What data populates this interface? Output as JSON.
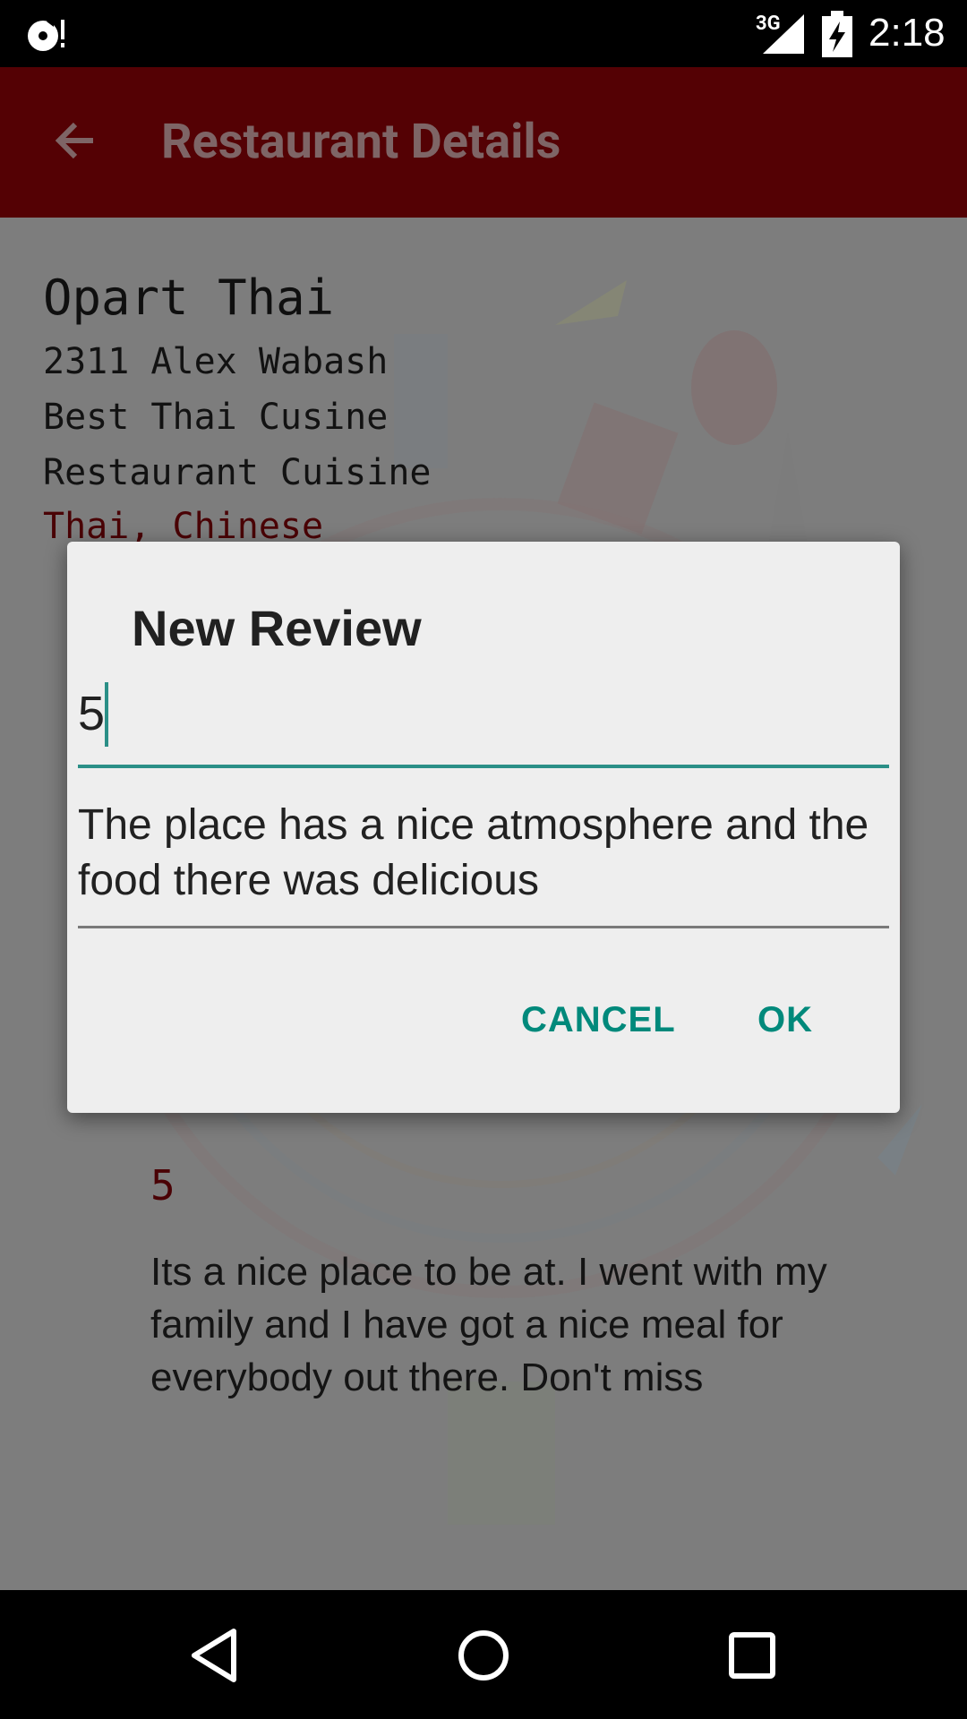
{
  "status_bar": {
    "network": "3G",
    "time": "2:18"
  },
  "app_bar": {
    "title": "Restaurant Details"
  },
  "restaurant": {
    "name": "Opart Thai",
    "address": "2311 Alex Wabash",
    "tagline": "Best Thai Cusine",
    "cuisine_label": "Restaurant Cuisine",
    "cuisines": "Thai, Chinese"
  },
  "review": {
    "rating": "5",
    "text": "Its a nice place to be at. I went with my family and I have got a nice meal for everybody out there. Don't miss"
  },
  "dialog": {
    "title": "New Review",
    "rating_value": "5",
    "review_value": "The place has a nice atmosphere and the food there was delicious",
    "cancel_label": "CANCEL",
    "ok_label": "OK"
  },
  "colors": {
    "app_bar": "#540104",
    "accent": "#00897b",
    "cuisine_text": "#4a0205"
  },
  "icons": [
    "notification-icon",
    "signal-icon",
    "battery-icon",
    "back-arrow-icon",
    "nav-back-icon",
    "nav-home-icon",
    "nav-recents-icon"
  ]
}
